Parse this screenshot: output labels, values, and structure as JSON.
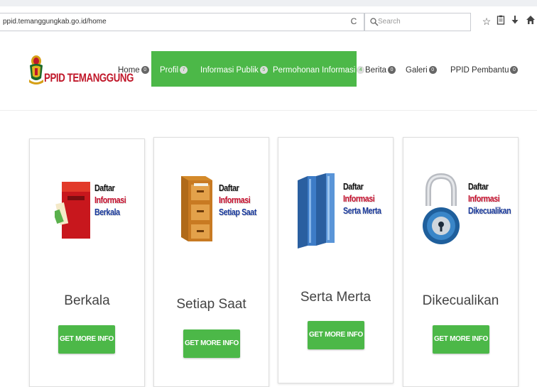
{
  "browser": {
    "url": "ppid.temanggungkab.go.id/home",
    "search_placeholder": "Search",
    "icons": [
      "reload-icon",
      "search-icon",
      "star-icon",
      "clipboard-icon",
      "download-icon",
      "home-icon"
    ]
  },
  "site": {
    "brand": "PPID TEMANGGUNG",
    "nav": [
      {
        "label": "Home",
        "badge": "0"
      },
      {
        "label": "Profil",
        "badge": "7"
      },
      {
        "label": "Informasi Publik",
        "badge": "5"
      },
      {
        "label": "Permohonan Informasi",
        "badge": "4"
      },
      {
        "label": "Berita",
        "badge": "0"
      },
      {
        "label": "Galeri",
        "badge": "0"
      },
      {
        "label": "PPID Pembantu",
        "badge": "0"
      }
    ],
    "colors": {
      "green": "#4cb848",
      "brand_red": "#c0182a"
    }
  },
  "cards": [
    {
      "title": "Berkala",
      "button": "GET MORE INFO",
      "image_lines": [
        "Daftar",
        "Informasi",
        "Berkala"
      ]
    },
    {
      "title": "Setiap Saat",
      "button": "GET MORE INFO",
      "image_lines": [
        "Daftar",
        "Informasi",
        "Setiap Saat"
      ]
    },
    {
      "title": "Serta Merta",
      "button": "GET MORE INFO",
      "image_lines": [
        "Daftar",
        "Informasi",
        "Serta Merta"
      ]
    },
    {
      "title": "Dikecualikan",
      "button": "GET MORE INFO",
      "image_lines": [
        "Daftar",
        "Informasi",
        "Dikecualikan"
      ]
    }
  ]
}
